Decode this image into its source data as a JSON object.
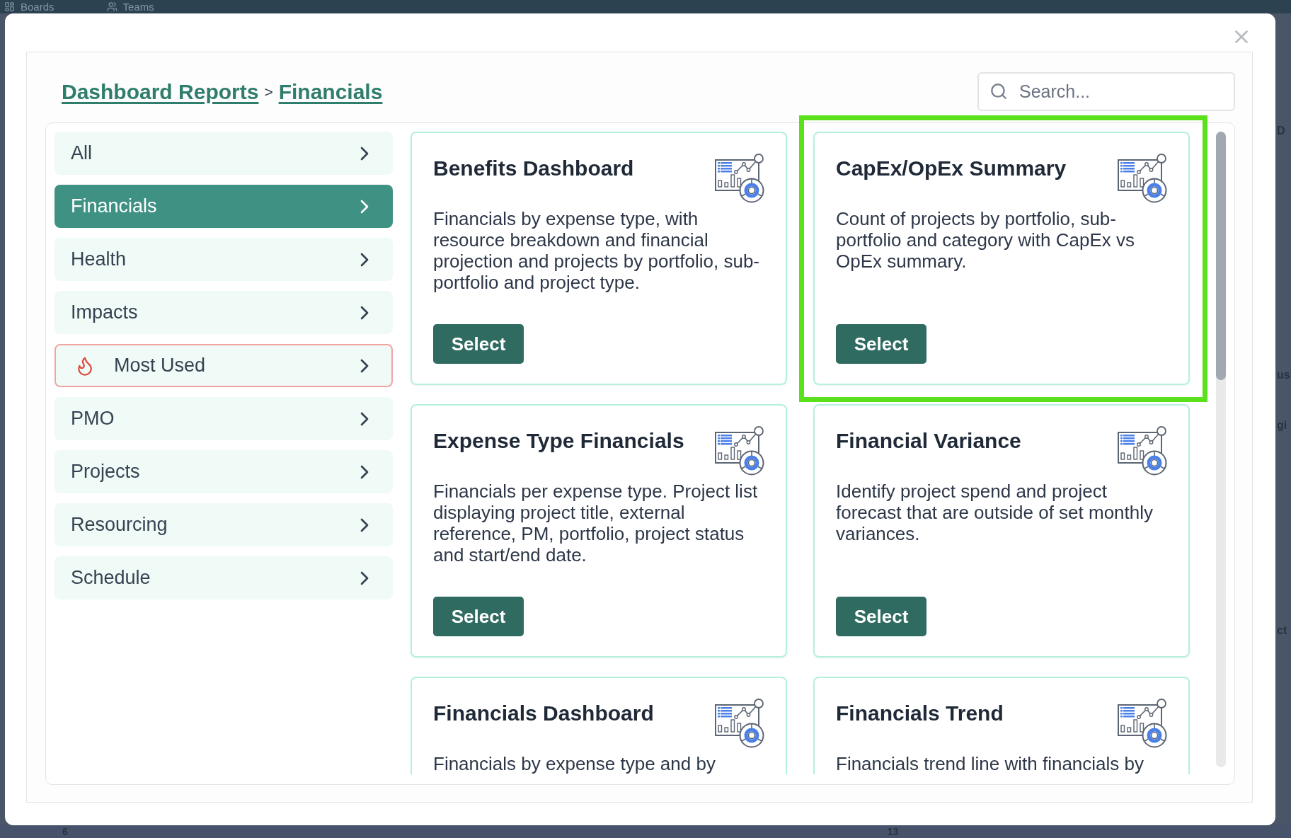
{
  "background": {
    "nav": [
      {
        "label": "Boards"
      },
      {
        "label": "Teams"
      }
    ],
    "side_fragments": [
      "D",
      "us",
      "gi",
      "ct"
    ],
    "bottom_fragments": [
      "6",
      "13"
    ]
  },
  "dialog": {
    "breadcrumb": [
      {
        "label": "Dashboard Reports"
      },
      {
        "label": "Financials"
      }
    ],
    "separator": ">",
    "search": {
      "placeholder": "Search..."
    }
  },
  "sidebar": {
    "items": [
      {
        "label": "All",
        "kind": "category",
        "selected": false
      },
      {
        "label": "Financials",
        "kind": "category",
        "selected": true
      },
      {
        "label": "Health",
        "kind": "category",
        "selected": false
      },
      {
        "label": "Impacts",
        "kind": "category",
        "selected": false
      },
      {
        "label": "Most Used",
        "kind": "flagged",
        "selected": false
      },
      {
        "label": "PMO",
        "kind": "category",
        "selected": false
      },
      {
        "label": "Projects",
        "kind": "category",
        "selected": false
      },
      {
        "label": "Resourcing",
        "kind": "category",
        "selected": false
      },
      {
        "label": "Schedule",
        "kind": "category",
        "selected": false
      }
    ]
  },
  "cards": [
    {
      "title": "Benefits Dashboard",
      "description": "Financials by expense type, with resource breakdown and financial projection and projects by portfolio, sub-portfolio and project type.",
      "button": "Select",
      "highlighted": false
    },
    {
      "title": "CapEx/OpEx Summary",
      "description": "Count of projects by portfolio, sub-portfolio and category with CapEx vs OpEx summary.",
      "button": "Select",
      "highlighted": true
    },
    {
      "title": "Expense Type Financials",
      "description": "Financials per expense type. Project list displaying project title, external reference, PM, portfolio, project status and start/end date.",
      "button": "Select",
      "highlighted": false
    },
    {
      "title": "Financial Variance",
      "description": "Identify project spend and project forecast that are outside of set monthly variances.",
      "button": "Select",
      "highlighted": false
    },
    {
      "title": "Financials Dashboard",
      "description": "Financials by expense type and by",
      "highlighted": false
    },
    {
      "title": "Financials Trend",
      "description": "Financials trend line with financials by",
      "highlighted": false
    }
  ]
}
